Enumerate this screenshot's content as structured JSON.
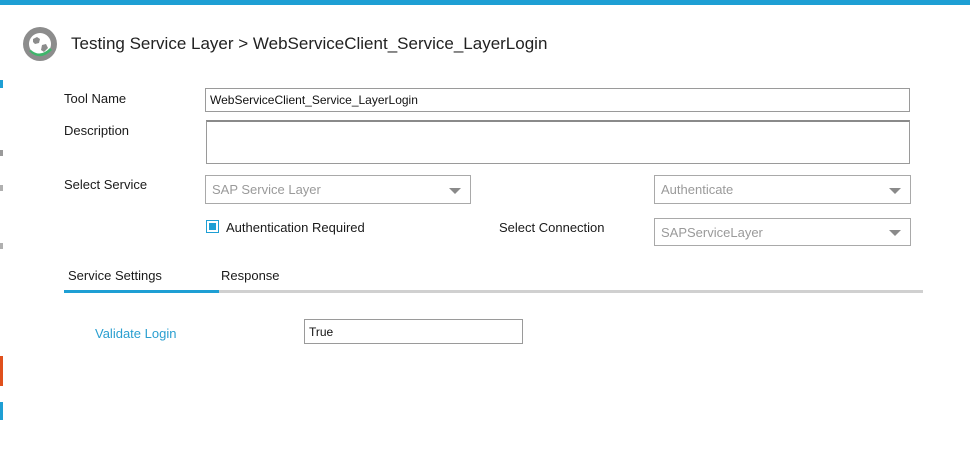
{
  "header": {
    "title": "Testing Service Layer > WebServiceClient_Service_LayerLogin",
    "icon": "globe-icon"
  },
  "form": {
    "tool_name_label": "Tool Name",
    "tool_name_value": "WebServiceClient_Service_LayerLogin",
    "description_label": "Description",
    "description_value": "",
    "select_service_label": "Select Service",
    "service_value": "SAP Service Layer",
    "method_value": "Authenticate",
    "auth_required_label": "Authentication Required",
    "auth_required_checked": true,
    "select_connection_label": "Select Connection",
    "connection_value": "SAPServiceLayer"
  },
  "tabs": [
    {
      "label": "Service Settings",
      "active": true
    },
    {
      "label": "Response",
      "active": false
    }
  ],
  "settings": {
    "validate_login_label": "Validate Login",
    "validate_login_value": "True"
  },
  "colors": {
    "accent": "#1e9fd4",
    "link": "#2a9fd0"
  }
}
